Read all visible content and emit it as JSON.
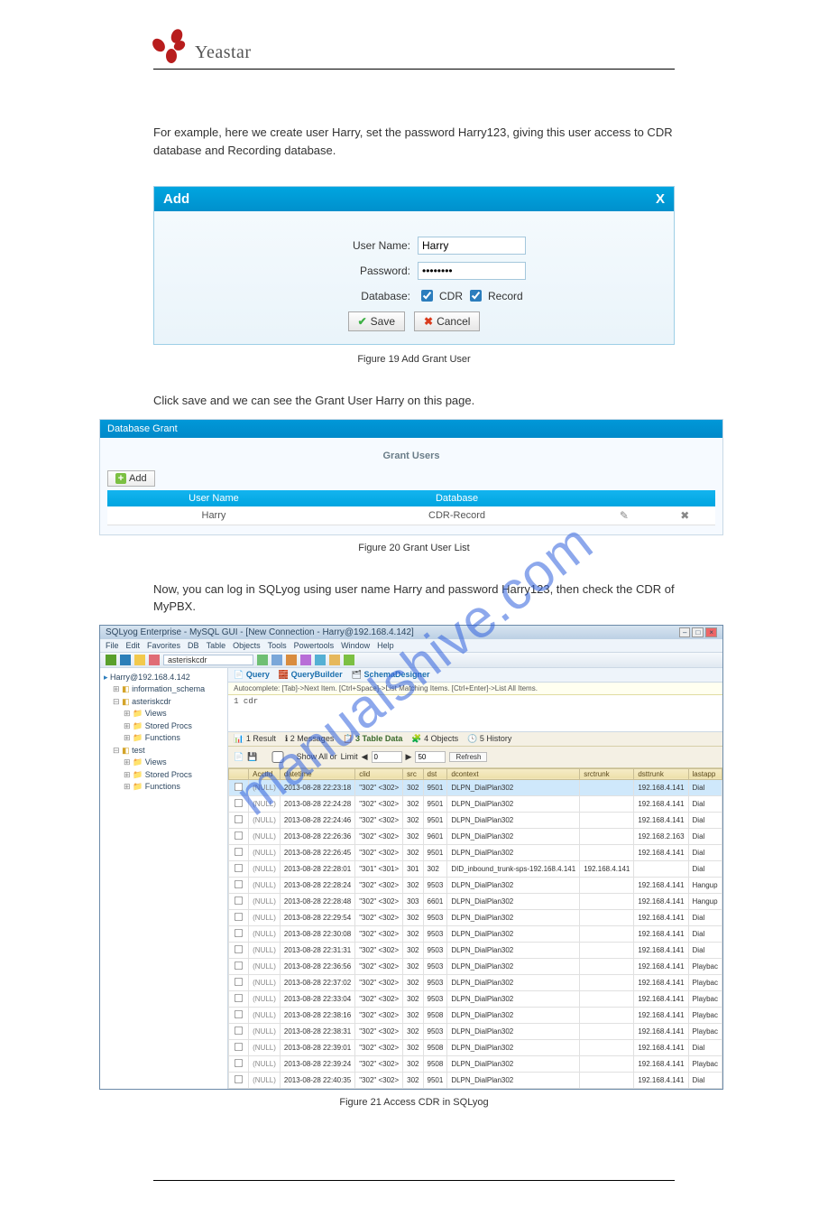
{
  "logo": {
    "text": "Yeastar"
  },
  "intro_text": "For example, here we create user Harry, set the password Harry123, giving this user access to CDR database and Recording database.",
  "add_dialog": {
    "title": "Add",
    "close": "X",
    "username_label": "User Name:",
    "username_value": "Harry",
    "password_label": "Password:",
    "password_value": "••••••••",
    "database_label": "Database:",
    "cdr_label": "CDR",
    "record_label": "Record",
    "save_label": "Save",
    "cancel_label": "Cancel"
  },
  "fig19_caption": "Figure 19 Add Grant User",
  "after_fig19_text": "Click save and we can see the Grant User Harry on this page.",
  "grant_panel": {
    "title": "Database Grant",
    "grant_users_h": "Grant Users",
    "add_label": "Add",
    "headers": {
      "username": "User Name",
      "database": "Database"
    },
    "row": {
      "username": "Harry",
      "database": "CDR-Record"
    }
  },
  "fig20_caption": "Figure 20 Grant User List",
  "after_fig20_text": "Now, you can log in SQLyog using user name Harry and password Harry123, then check the CDR of MyPBX.",
  "sqlyog": {
    "title": "SQLyog Enterprise - MySQL GUI - [New Connection - Harry@192.168.4.142]",
    "menubar": [
      "File",
      "Edit",
      "Favorites",
      "DB",
      "Table",
      "Objects",
      "Tools",
      "Powertools",
      "Window",
      "Help"
    ],
    "db_selected": "asteriskcdr",
    "tree": {
      "root": "Harry@192.168.4.142",
      "db1": "information_schema",
      "db2": "asteriskcdr",
      "db2_children": [
        "Views",
        "Stored Procs",
        "Functions"
      ],
      "db3": "test",
      "db3_children": [
        "Views",
        "Stored Procs",
        "Functions"
      ]
    },
    "tabs_top": [
      "Query",
      "QueryBuilder",
      "SchemaDesigner"
    ],
    "autocomplete": "Autocomplete: [Tab]->Next Item. [Ctrl+Space]->List Matching Items. [Ctrl+Enter]->List All Items.",
    "query_text": "1  cdr",
    "result_tabs": [
      "1 Result",
      "2 Messages",
      "3 Table Data",
      "4 Objects",
      "5 History"
    ],
    "tools": {
      "show_all": "Show All  or",
      "limit": "Limit",
      "page_from": "0",
      "page_to": "50",
      "refresh": "Refresh"
    },
    "columns": [
      "",
      "AcctId",
      "datetime",
      "clid",
      "src",
      "dst",
      "dcontext",
      "srctrunk",
      "dsttrunk",
      "lastapp"
    ],
    "rows": [
      [
        "(NULL)",
        "2013-08-28 22:23:18",
        "\"302\" <302>",
        "302",
        "9501",
        "DLPN_DialPlan302",
        "",
        "192.168.4.141",
        "Dial"
      ],
      [
        "(NULL)",
        "2013-08-28 22:24:28",
        "\"302\" <302>",
        "302",
        "9501",
        "DLPN_DialPlan302",
        "",
        "192.168.4.141",
        "Dial"
      ],
      [
        "(NULL)",
        "2013-08-28 22:24:46",
        "\"302\" <302>",
        "302",
        "9501",
        "DLPN_DialPlan302",
        "",
        "192.168.4.141",
        "Dial"
      ],
      [
        "(NULL)",
        "2013-08-28 22:26:36",
        "\"302\" <302>",
        "302",
        "9601",
        "DLPN_DialPlan302",
        "",
        "192.168.2.163",
        "Dial"
      ],
      [
        "(NULL)",
        "2013-08-28 22:26:45",
        "\"302\" <302>",
        "302",
        "9501",
        "DLPN_DialPlan302",
        "",
        "192.168.4.141",
        "Dial"
      ],
      [
        "(NULL)",
        "2013-08-28 22:28:01",
        "\"301\" <301>",
        "301",
        "302",
        "DID_inbound_trunk-sps-192.168.4.141",
        "192.168.4.141",
        "",
        "Dial"
      ],
      [
        "(NULL)",
        "2013-08-28 22:28:24",
        "\"302\" <302>",
        "302",
        "9503",
        "DLPN_DialPlan302",
        "",
        "192.168.4.141",
        "Hangup"
      ],
      [
        "(NULL)",
        "2013-08-28 22:28:48",
        "\"302\" <302>",
        "303",
        "6601",
        "DLPN_DialPlan302",
        "",
        "192.168.4.141",
        "Hangup"
      ],
      [
        "(NULL)",
        "2013-08-28 22:29:54",
        "\"302\" <302>",
        "302",
        "9503",
        "DLPN_DialPlan302",
        "",
        "192.168.4.141",
        "Dial"
      ],
      [
        "(NULL)",
        "2013-08-28 22:30:08",
        "\"302\" <302>",
        "302",
        "9503",
        "DLPN_DialPlan302",
        "",
        "192.168.4.141",
        "Dial"
      ],
      [
        "(NULL)",
        "2013-08-28 22:31:31",
        "\"302\" <302>",
        "302",
        "9503",
        "DLPN_DialPlan302",
        "",
        "192.168.4.141",
        "Dial"
      ],
      [
        "(NULL)",
        "2013-08-28 22:36:56",
        "\"302\" <302>",
        "302",
        "9503",
        "DLPN_DialPlan302",
        "",
        "192.168.4.141",
        "Playbac"
      ],
      [
        "(NULL)",
        "2013-08-28 22:37:02",
        "\"302\" <302>",
        "302",
        "9503",
        "DLPN_DialPlan302",
        "",
        "192.168.4.141",
        "Playbac"
      ],
      [
        "(NULL)",
        "2013-08-28 22:33:04",
        "\"302\" <302>",
        "302",
        "9503",
        "DLPN_DialPlan302",
        "",
        "192.168.4.141",
        "Playbac"
      ],
      [
        "(NULL)",
        "2013-08-28 22:38:16",
        "\"302\" <302>",
        "302",
        "9508",
        "DLPN_DialPlan302",
        "",
        "192.168.4.141",
        "Playbac"
      ],
      [
        "(NULL)",
        "2013-08-28 22:38:31",
        "\"302\" <302>",
        "302",
        "9503",
        "DLPN_DialPlan302",
        "",
        "192.168.4.141",
        "Playbac"
      ],
      [
        "(NULL)",
        "2013-08-28 22:39:01",
        "\"302\" <302>",
        "302",
        "9508",
        "DLPN_DialPlan302",
        "",
        "192.168.4.141",
        "Dial"
      ],
      [
        "(NULL)",
        "2013-08-28 22:39:24",
        "\"302\" <302>",
        "302",
        "9508",
        "DLPN_DialPlan302",
        "",
        "192.168.4.141",
        "Playbac"
      ],
      [
        "(NULL)",
        "2013-08-28 22:40:35",
        "\"302\" <302>",
        "302",
        "9501",
        "DLPN_DialPlan302",
        "",
        "192.168.4.141",
        "Dial"
      ]
    ]
  },
  "fig21_caption": "Figure 21 Access CDR in SQLyog",
  "watermark": "manualshive.com"
}
